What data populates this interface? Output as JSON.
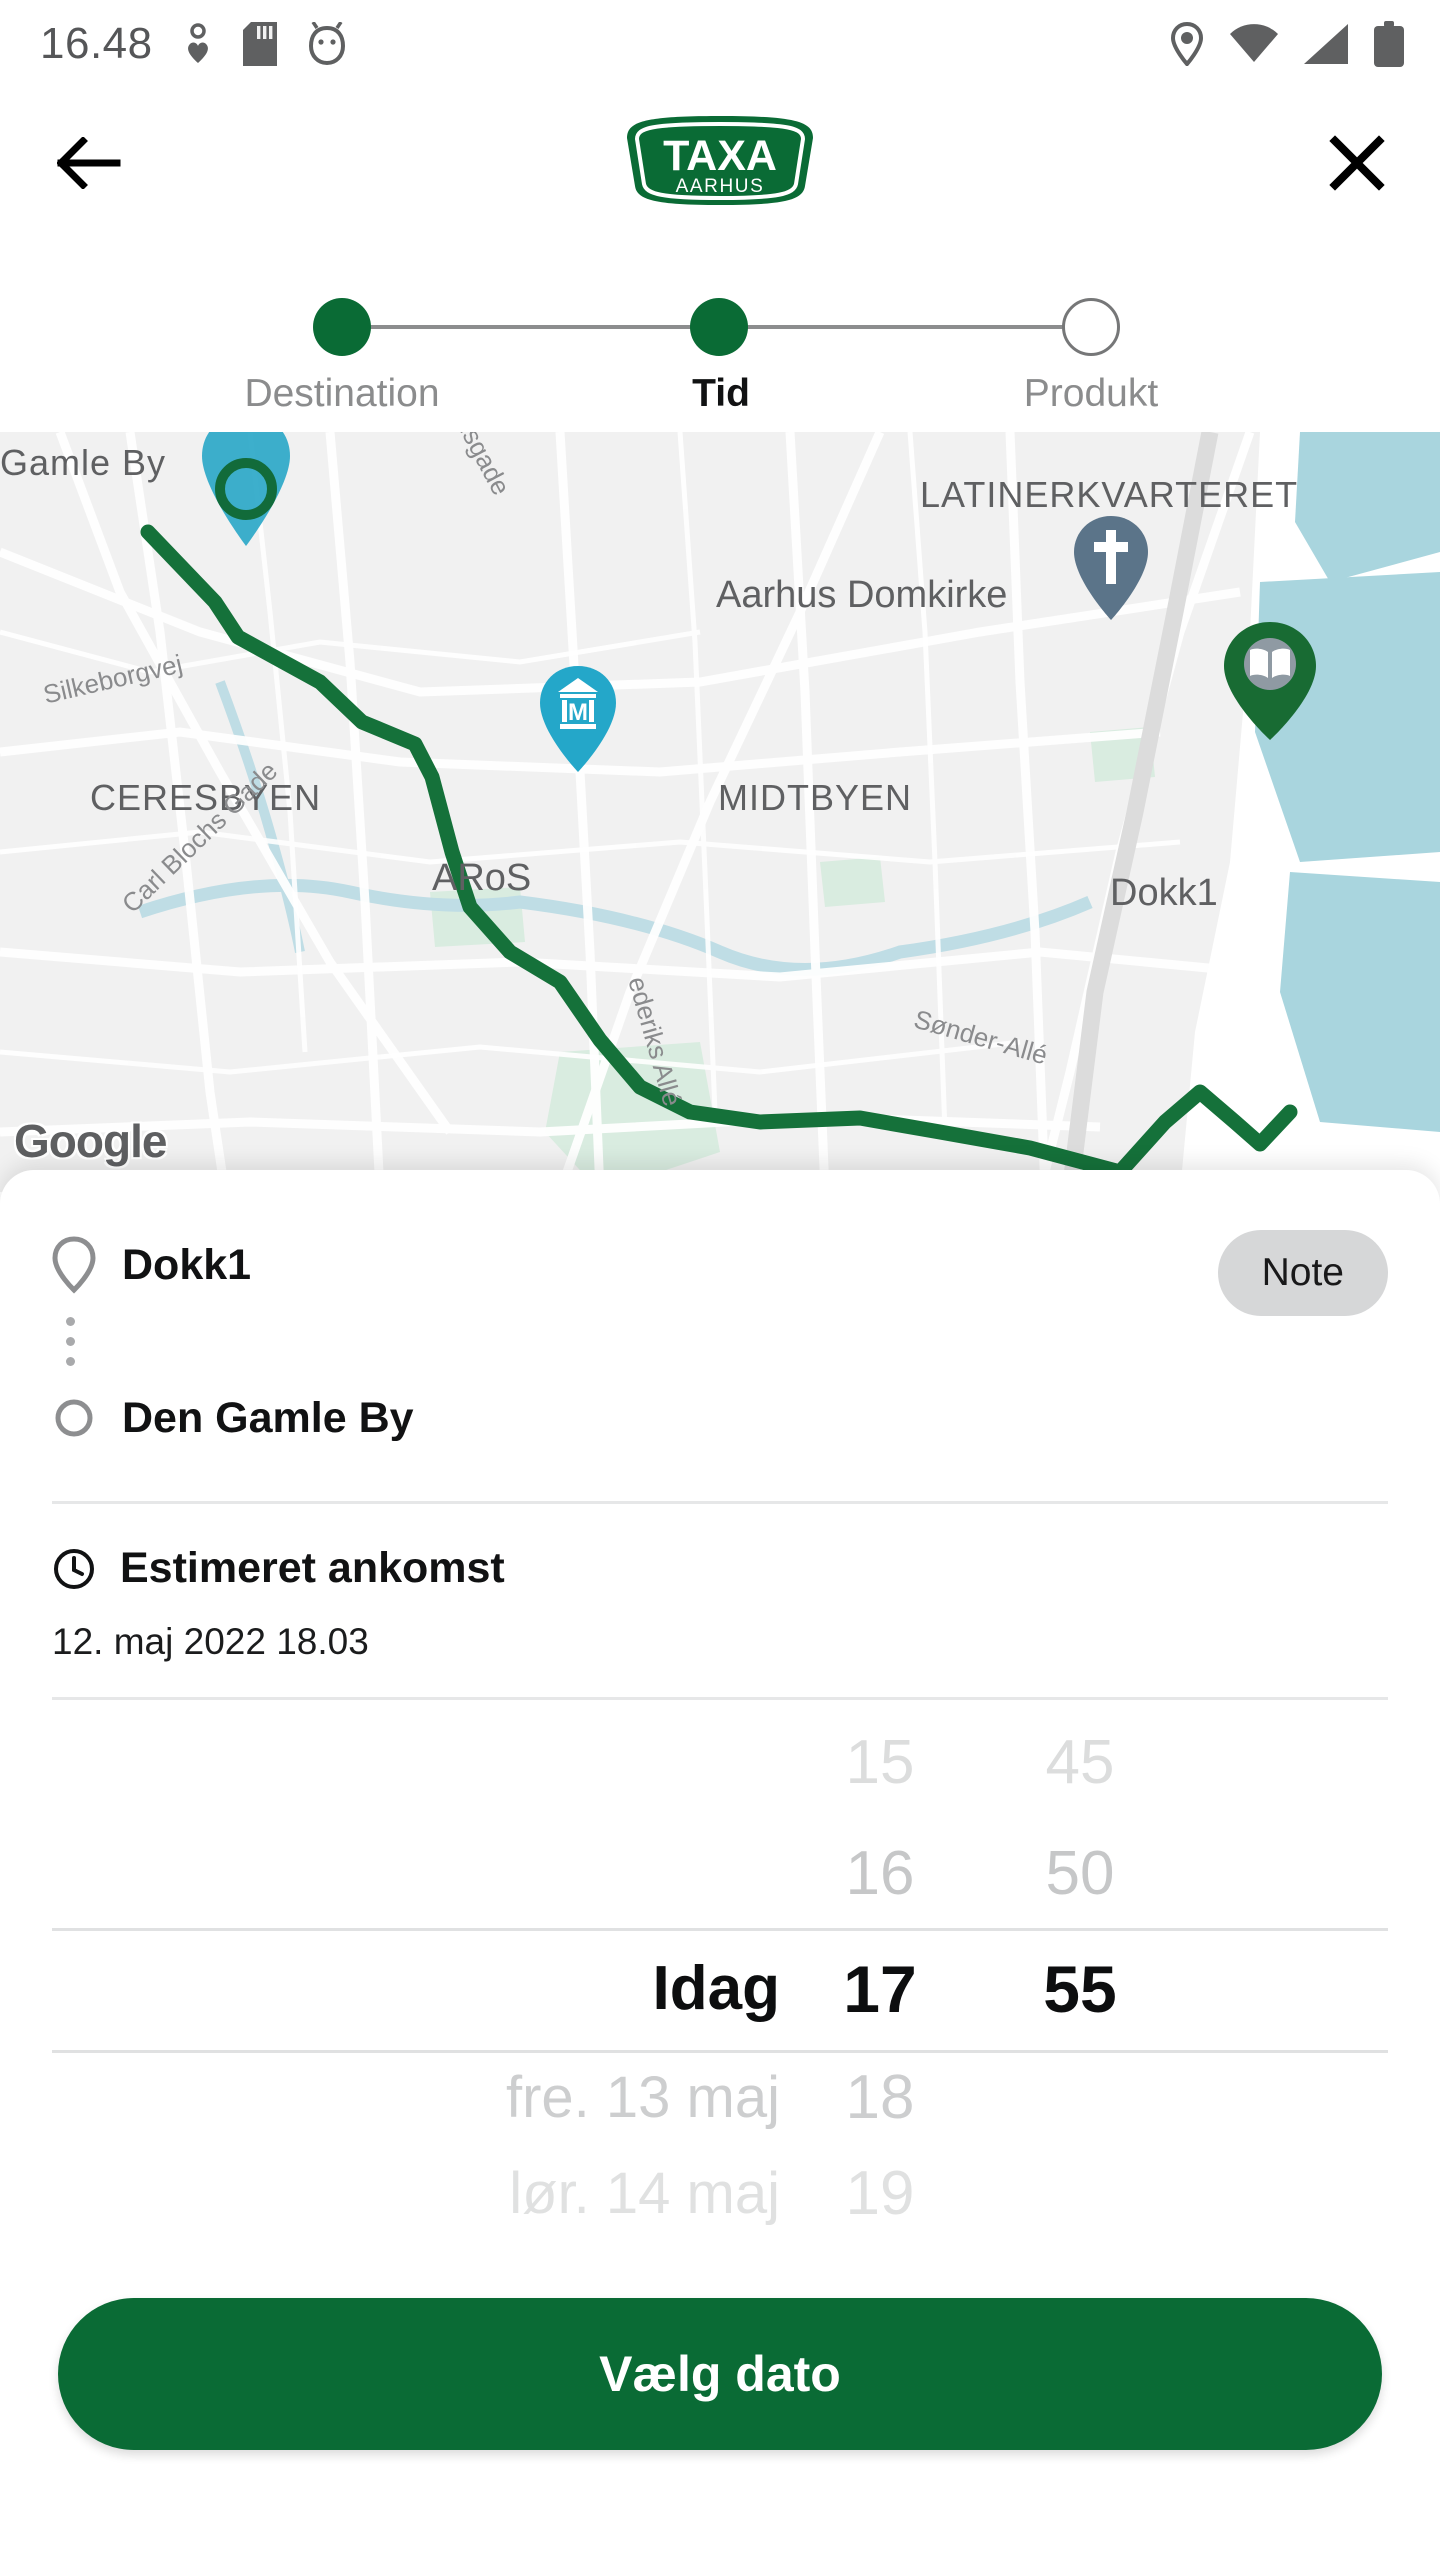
{
  "status_bar": {
    "time": "16.48",
    "icons_left": [
      "bluetooth-heart-icon",
      "sd-card-icon",
      "android-debug-icon"
    ],
    "icons_right": [
      "location-icon",
      "wifi-icon",
      "cellular-signal-icon",
      "battery-icon"
    ]
  },
  "app_bar": {
    "back_icon": "back-arrow-icon",
    "close_icon": "close-icon",
    "logo_primary": "TAXA",
    "logo_secondary": "AARHUS"
  },
  "stepper": {
    "steps": [
      {
        "label": "Destination",
        "state": "done"
      },
      {
        "label": "Tid",
        "state": "current"
      },
      {
        "label": "Produkt",
        "state": "upcoming"
      }
    ]
  },
  "map": {
    "attribution": "Google",
    "areas": [
      "Gamle By",
      "LATINERKVARTERET",
      "CERESBYEN",
      "MIDTBYEN"
    ],
    "pois": [
      "Aarhus Domkirke",
      "ARoS",
      "Dokk1"
    ],
    "streets": [
      "nsgade",
      "Silkeborgvej",
      "Carl Blochs Gade",
      "Frederiks Allé",
      "Sønder Allé"
    ],
    "labels": {
      "gamle_by": "Gamle By",
      "latinerkvarteret": "LATINERKVARTERET",
      "domkirke": "Aarhus Domkirke",
      "ceresbyen": "CERESBYEN",
      "midtbyen": "MIDTBYEN",
      "aros": "ARoS",
      "dokk1": "Dokk1",
      "nsgade": "nsgade",
      "silkeborgvej": "Silkeborgvej",
      "carl_blochs_gade": "Carl Blochs Gade",
      "frederiks_alle": "ederiks Allé",
      "sonder_alle": "Sønder-Allé"
    },
    "pins": [
      "destination-pin-gamle-by",
      "church-pin-domkirke",
      "museum-pin-aros",
      "library-pin-dokk1"
    ]
  },
  "route": {
    "pickup": "Dokk1",
    "dropoff": "Den Gamle By",
    "note_label": "Note"
  },
  "eta": {
    "title": "Estimeret ankomst",
    "value": "12. maj 2022 18.03"
  },
  "picker": {
    "dates": [
      "",
      "",
      "Idag",
      "fre. 13 maj",
      "lør. 14 maj"
    ],
    "hours": [
      "15",
      "16",
      "17",
      "18",
      "19"
    ],
    "minutes": [
      "45",
      "50",
      "55",
      "",
      ""
    ],
    "selected": {
      "date": "Idag",
      "hour": "17",
      "minute": "55"
    }
  },
  "cta": {
    "label": "Vælg dato"
  },
  "colors": {
    "brand_green": "#0a6b35",
    "route_line": "#15713a",
    "note_chip": "#d6d7d8",
    "muted_text": "#8b8c8d",
    "map_water": "#a9d5de"
  }
}
